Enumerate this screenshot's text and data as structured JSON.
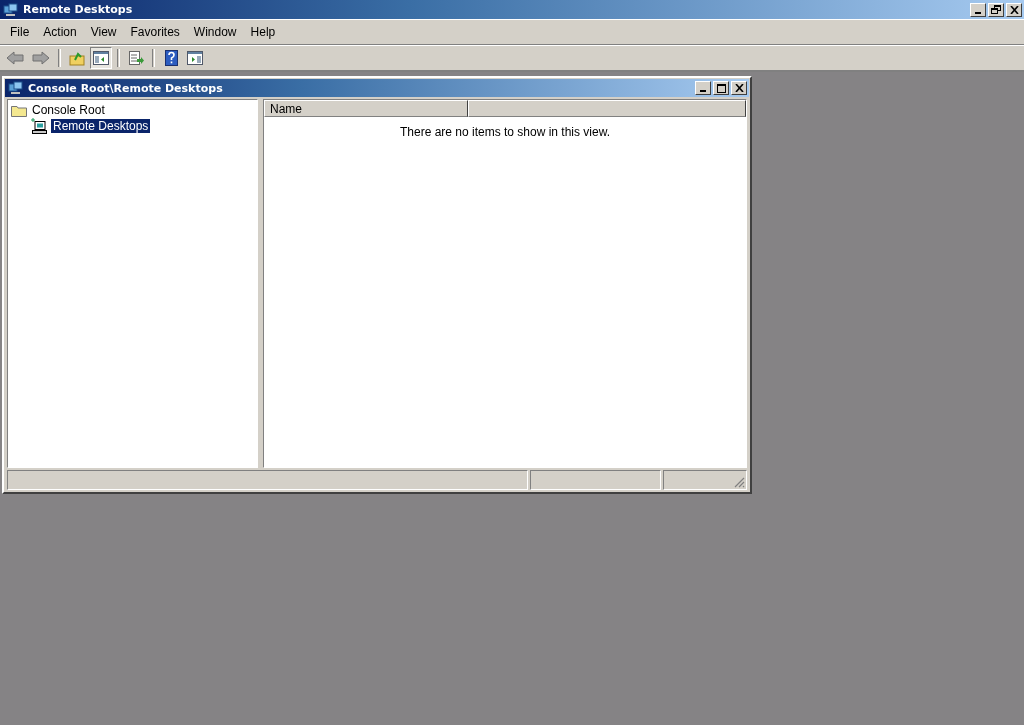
{
  "window": {
    "title": "Remote Desktops"
  },
  "menu": [
    "File",
    "Action",
    "View",
    "Favorites",
    "Window",
    "Help"
  ],
  "toolbar": [
    {
      "kind": "back",
      "pressed": false
    },
    {
      "kind": "forward",
      "pressed": false
    },
    {
      "kind": "sep"
    },
    {
      "kind": "up",
      "pressed": false
    },
    {
      "kind": "tree",
      "pressed": true
    },
    {
      "kind": "sep"
    },
    {
      "kind": "export",
      "pressed": false
    },
    {
      "kind": "sep"
    },
    {
      "kind": "help",
      "pressed": false
    },
    {
      "kind": "pane",
      "pressed": false
    }
  ],
  "child": {
    "title": "Console Root\\Remote Desktops",
    "tree": [
      {
        "label": "Console Root",
        "selected": false,
        "children": [
          {
            "label": "Remote Desktops",
            "selected": true
          }
        ]
      }
    ],
    "columns": [
      {
        "label": "Name"
      }
    ],
    "empty_message": "There are no items to show in this view."
  }
}
